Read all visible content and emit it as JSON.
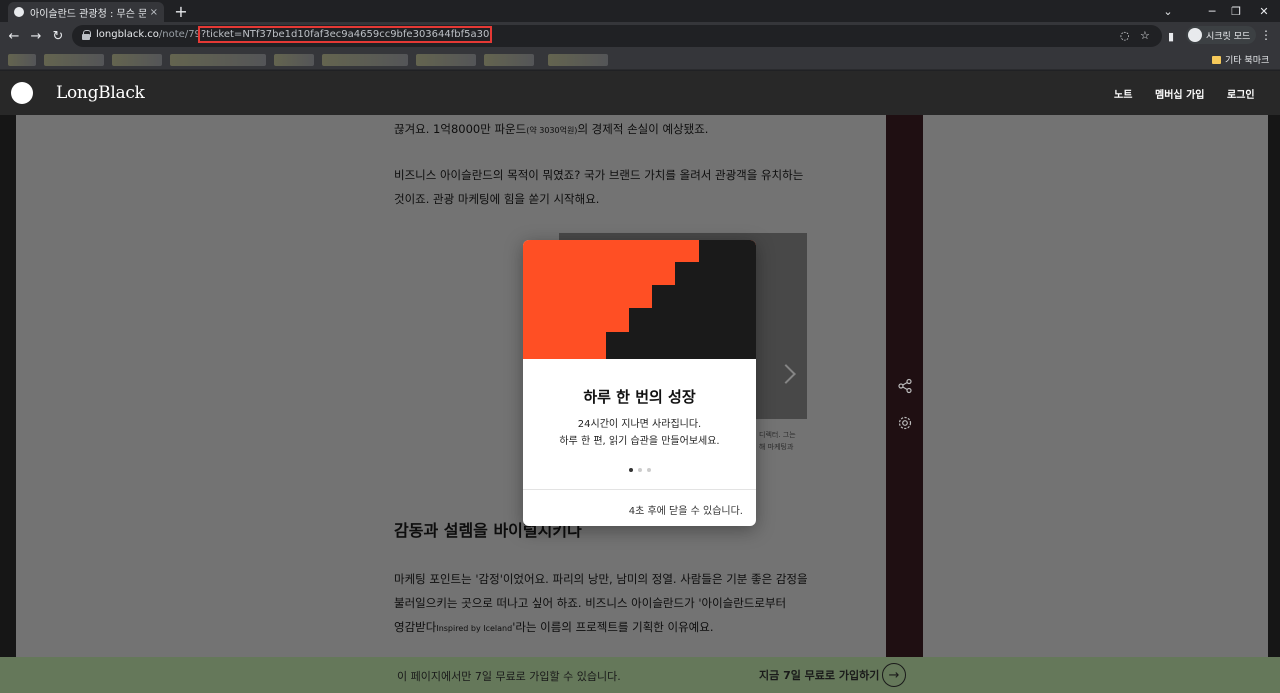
{
  "browser": {
    "tab_title": "아이슬란드 관광청 : 무슨 문제가",
    "tab_close": "×",
    "new_tab": "+",
    "url_host": "longblack.co",
    "url_path": "/note/79",
    "url_query": "?ticket=NTf37be1d10faf3ec9a4659cc9bfe303644fbf5a30",
    "profile_label": "시크릿 모드",
    "other_bookmarks": "기타 북마크"
  },
  "site": {
    "logo": "LongBlack",
    "nav": [
      "노트",
      "멤버십 가입",
      "로그인"
    ]
  },
  "article": {
    "p1_a": "끊겨요. 1억8000만 파운드",
    "p1_small": "(약 3030억원)",
    "p1_b": "의 경제적 손실이 예상됐죠.",
    "p2_l1": "비즈니스 아이슬란드의 목적이 뭐였죠? 국가 브랜드 가치를 올려서 관광객을 유치하는",
    "p2_l2": "것이죠. 관광 마케팅에 힘을 쏟기 시작해요.",
    "caption_l1": "디렉터. 그는",
    "caption_l2": "해 마케팅과",
    "heading": "감동과 설렘을 바이럴시키다",
    "p3_l1": "마케팅 포인트는 '감정'이었어요. 파리의 낭만, 남미의 정열. 사람들은 기분 좋은 감정을",
    "p3_l2": "불러일으키는 곳으로 떠나고 싶어 하죠. 비즈니스 아이슬란드가 '아이슬란드로부터",
    "p3_l3a": "영감받다",
    "p3_l3_small": "Inspired by Iceland",
    "p3_l3b": "'라는 이름의 프로젝트를 기획한 이유예요."
  },
  "modal": {
    "title": "하루 한 번의 성장",
    "sub_l1": "24시간이 지나면 사라집니다.",
    "sub_l2": "하루 한 편, 읽기 습관을 만들어보세요.",
    "footer": "4초 후에 닫을 수 있습니다.",
    "page_count": 3,
    "active_page": 1,
    "colors": {
      "orange": "#ff4f24",
      "dark": "#1a1a1a"
    }
  },
  "promo": {
    "text": "이 페이지에서만 7일 무료로 가입할 수 있습니다.",
    "cta": "지금 7일 무료로 가입하기",
    "arrow": "→"
  },
  "icons": [
    "lock-icon",
    "share-icon",
    "gear-icon",
    "chevron-right-icon",
    "arrow-right-icon",
    "star-icon"
  ]
}
